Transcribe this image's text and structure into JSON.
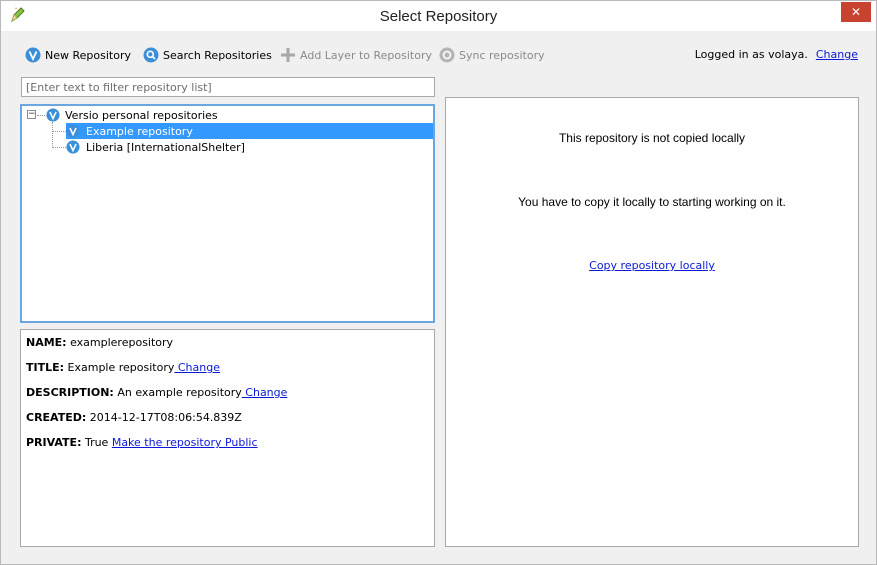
{
  "window": {
    "title": "Select Repository",
    "close_label": "✕"
  },
  "toolbar": {
    "new_repository": "New Repository",
    "search_repositories": "Search Repositories",
    "add_layer": "Add Layer to Repository",
    "sync_repository": "Sync repository",
    "logged_in_text": "Logged in as volaya.",
    "change_label": "Change"
  },
  "filter": {
    "placeholder": "[Enter text to filter repository list]",
    "value": ""
  },
  "tree": {
    "root_label": "Versio personal repositories",
    "items": [
      {
        "label": "Example repository",
        "selected": true
      },
      {
        "label": "Liberia [InternationalShelter]",
        "selected": false
      }
    ]
  },
  "details": {
    "name_label": "NAME:",
    "name_value": " examplerepository",
    "title_label": "TITLE:",
    "title_value": " Example repository",
    "title_change": " Change",
    "description_label": "DESCRIPTION:",
    "description_value": " An example repository",
    "description_change": " Change",
    "created_label": "CREATED:",
    "created_value": " 2014-12-17T08:06:54.839Z",
    "private_label": "PRIVATE:",
    "private_value": " True ",
    "private_link": "Make the repository Public"
  },
  "right_panel": {
    "message1": "This repository is not copied locally",
    "message2": "You have to copy it locally to starting working on it.",
    "copy_link": "Copy repository locally"
  },
  "colors": {
    "accent": "#3399ff",
    "link": "#0b19d8",
    "close": "#c7432f",
    "v_icon": "#3a8fd8"
  }
}
